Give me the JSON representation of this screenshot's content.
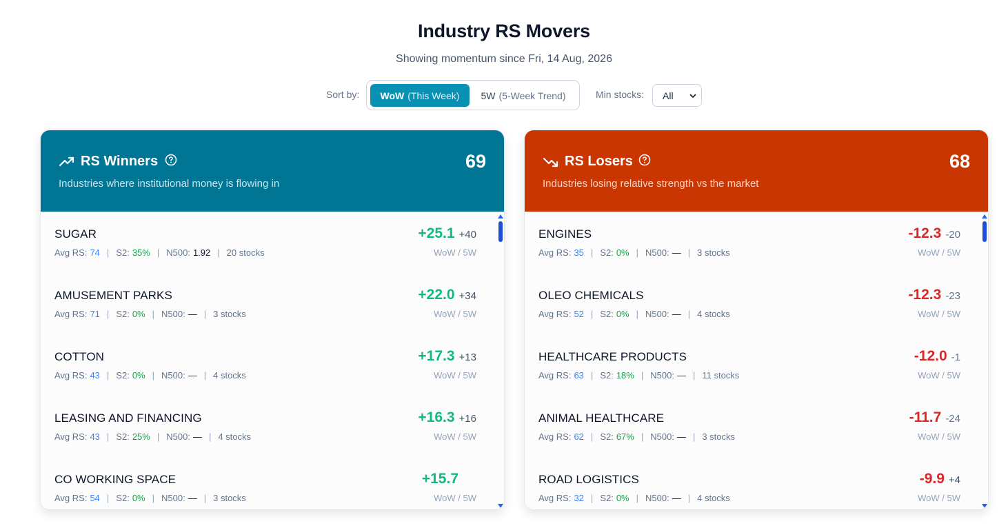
{
  "header": {
    "title": "Industry RS Movers",
    "subtitle": "Showing momentum since Fri, 14 Aug, 2026"
  },
  "controls": {
    "sort_label": "Sort by:",
    "sort_options": [
      {
        "short": "WoW",
        "long": "(This Week)",
        "active": true
      },
      {
        "short": "5W",
        "long": "(5-Week Trend)",
        "active": false
      }
    ],
    "min_stocks_label": "Min stocks:",
    "min_stocks_value": "All"
  },
  "colors": {
    "winners_header": "#007694",
    "losers_header": "#c93602",
    "accent_button": "#0891b2",
    "positive": "#10b981",
    "negative": "#dc2626",
    "link_blue": "#3b82f6"
  },
  "winners": {
    "icon": "trending-up-icon",
    "title": "RS Winners",
    "count": "69",
    "description": "Industries where institutional money is flowing in",
    "rows": [
      {
        "name": "SUGAR",
        "avg_label": "Avg RS:",
        "avg_rs": "74",
        "s2_label": "S2:",
        "s2": "35%",
        "n500_label": "N500:",
        "n500": "1.92",
        "stocks": "20 stocks",
        "wow": "+25.1",
        "w5": "+40",
        "caption": "WoW / 5W"
      },
      {
        "name": "AMUSEMENT PARKS",
        "avg_label": "Avg RS:",
        "avg_rs": "71",
        "s2_label": "S2:",
        "s2": "0%",
        "n500_label": "N500:",
        "n500": "—",
        "stocks": "3 stocks",
        "wow": "+22.0",
        "w5": "+34",
        "caption": "WoW / 5W"
      },
      {
        "name": "COTTON",
        "avg_label": "Avg RS:",
        "avg_rs": "43",
        "s2_label": "S2:",
        "s2": "0%",
        "n500_label": "N500:",
        "n500": "—",
        "stocks": "4 stocks",
        "wow": "+17.3",
        "w5": "+13",
        "caption": "WoW / 5W"
      },
      {
        "name": "LEASING AND FINANCING",
        "avg_label": "Avg RS:",
        "avg_rs": "43",
        "s2_label": "S2:",
        "s2": "25%",
        "n500_label": "N500:",
        "n500": "—",
        "stocks": "4 stocks",
        "wow": "+16.3",
        "w5": "+16",
        "caption": "WoW / 5W"
      },
      {
        "name": "CO WORKING SPACE",
        "avg_label": "Avg RS:",
        "avg_rs": "54",
        "s2_label": "S2:",
        "s2": "0%",
        "n500_label": "N500:",
        "n500": "—",
        "stocks": "3 stocks",
        "wow": "+15.7",
        "w5": "",
        "caption": "WoW / 5W"
      }
    ]
  },
  "losers": {
    "icon": "trending-down-icon",
    "title": "RS Losers",
    "count": "68",
    "description": "Industries losing relative strength vs the market",
    "rows": [
      {
        "name": "ENGINES",
        "avg_label": "Avg RS:",
        "avg_rs": "35",
        "s2_label": "S2:",
        "s2": "0%",
        "n500_label": "N500:",
        "n500": "—",
        "stocks": "3 stocks",
        "wow": "-12.3",
        "w5": "-20",
        "caption": "WoW / 5W"
      },
      {
        "name": "OLEO CHEMICALS",
        "avg_label": "Avg RS:",
        "avg_rs": "52",
        "s2_label": "S2:",
        "s2": "0%",
        "n500_label": "N500:",
        "n500": "—",
        "stocks": "4 stocks",
        "wow": "-12.3",
        "w5": "-23",
        "caption": "WoW / 5W"
      },
      {
        "name": "HEALTHCARE PRODUCTS",
        "avg_label": "Avg RS:",
        "avg_rs": "63",
        "s2_label": "S2:",
        "s2": "18%",
        "n500_label": "N500:",
        "n500": "—",
        "stocks": "11 stocks",
        "wow": "-12.0",
        "w5": "-1",
        "caption": "WoW / 5W"
      },
      {
        "name": "ANIMAL HEALTHCARE",
        "avg_label": "Avg RS:",
        "avg_rs": "62",
        "s2_label": "S2:",
        "s2": "67%",
        "n500_label": "N500:",
        "n500": "—",
        "stocks": "3 stocks",
        "wow": "-11.7",
        "w5": "-24",
        "caption": "WoW / 5W"
      },
      {
        "name": "ROAD LOGISTICS",
        "avg_label": "Avg RS:",
        "avg_rs": "32",
        "s2_label": "S2:",
        "s2": "0%",
        "n500_label": "N500:",
        "n500": "—",
        "stocks": "4 stocks",
        "wow": "-9.9",
        "w5": "+4",
        "caption": "WoW / 5W"
      }
    ]
  }
}
